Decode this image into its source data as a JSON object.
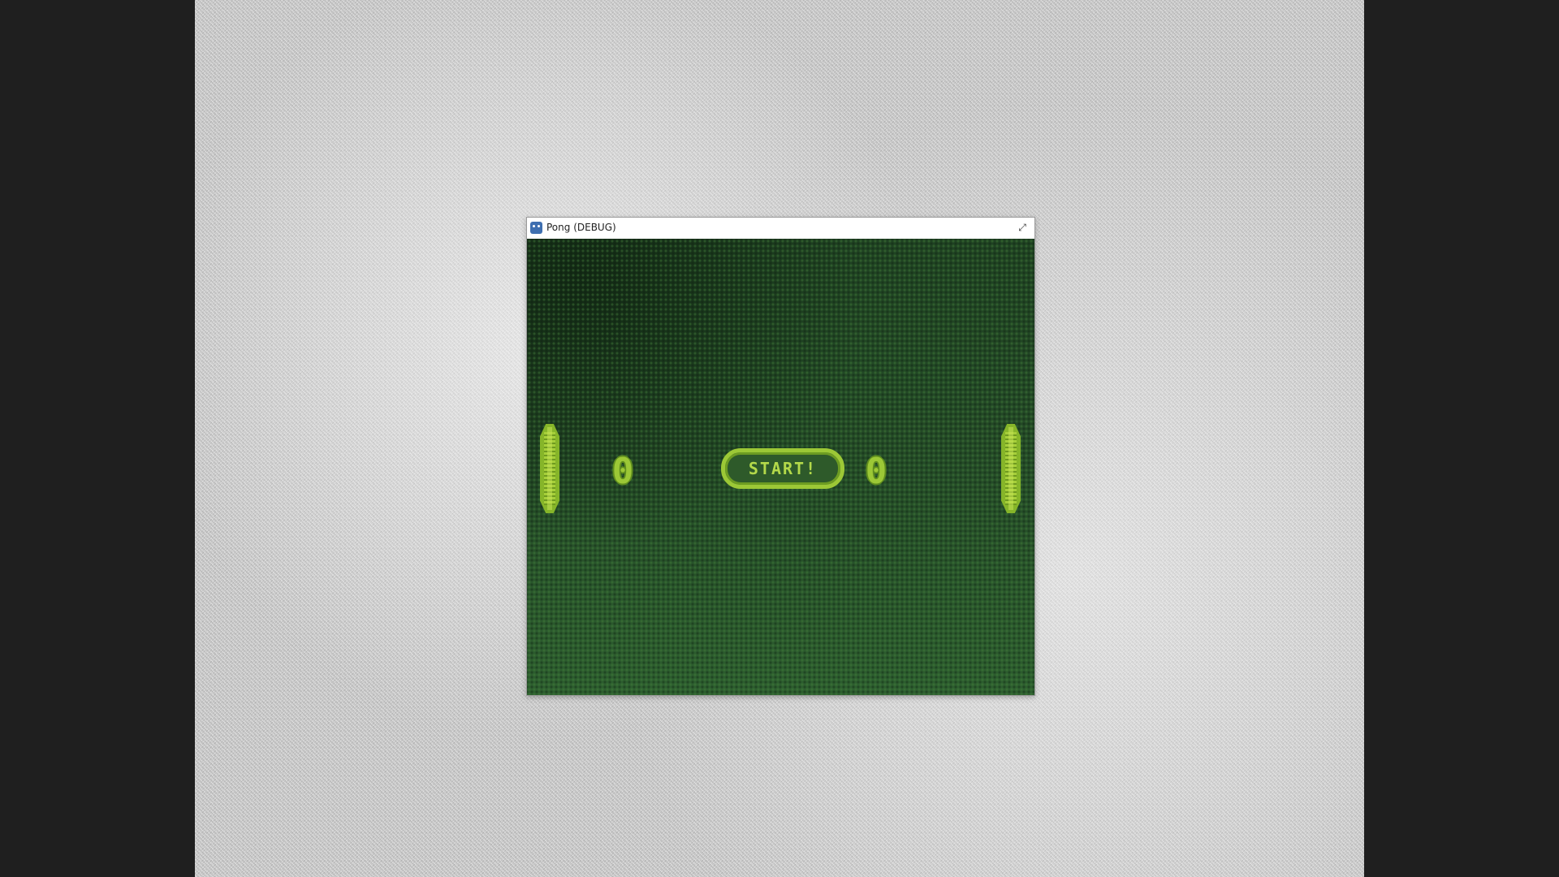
{
  "window": {
    "title": "Pong (DEBUG)",
    "app_icon": "godot-engine-icon",
    "resize_icon": "diagonal-resize-icon",
    "resize_glyph": "⤢"
  },
  "game": {
    "score_left": "0",
    "score_right": "0",
    "start_button_label": "START!",
    "palette": {
      "background_dark": "#1f4222",
      "background_light": "#2d5e2f",
      "accent": "#9cc836",
      "accent_dark": "#6d9c22"
    }
  }
}
